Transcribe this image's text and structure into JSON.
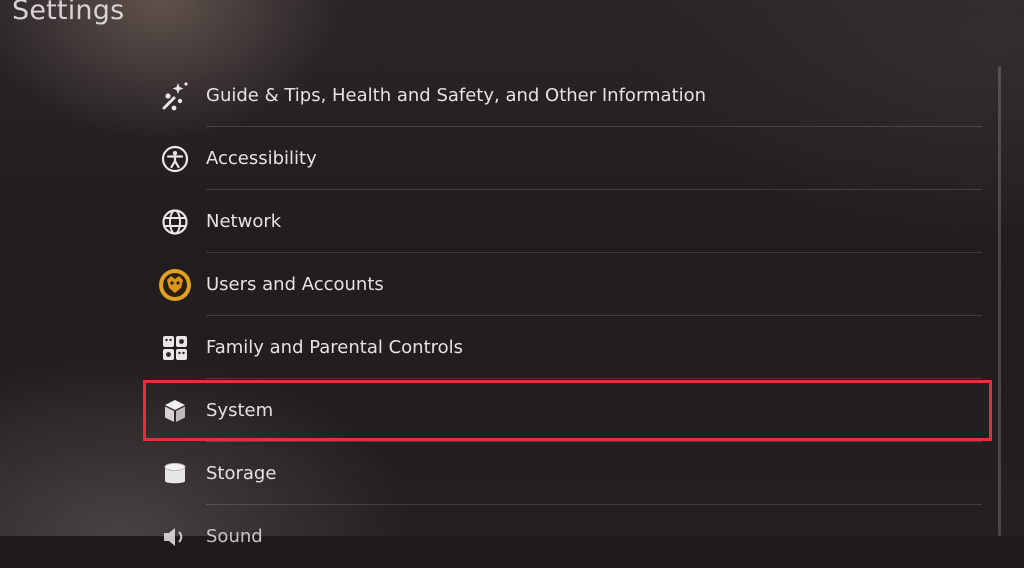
{
  "header": {
    "title": "Settings"
  },
  "menu": {
    "items": [
      {
        "label": "Guide & Tips, Health and Safety, and Other Information",
        "icon": "tips-sparkle-icon"
      },
      {
        "label": "Accessibility",
        "icon": "accessibility-icon"
      },
      {
        "label": "Network",
        "icon": "globe-icon"
      },
      {
        "label": "Users and Accounts",
        "icon": "user-avatar-icon"
      },
      {
        "label": "Family and Parental Controls",
        "icon": "family-controls-icon"
      },
      {
        "label": "System",
        "icon": "cube-icon",
        "highlighted": true
      },
      {
        "label": "Storage",
        "icon": "storage-cylinder-icon"
      },
      {
        "label": "Sound",
        "icon": "speaker-icon"
      }
    ]
  },
  "colors": {
    "highlight_border": "#e0313c",
    "background": "#1f1b1d",
    "text": "#e6e2e1"
  }
}
